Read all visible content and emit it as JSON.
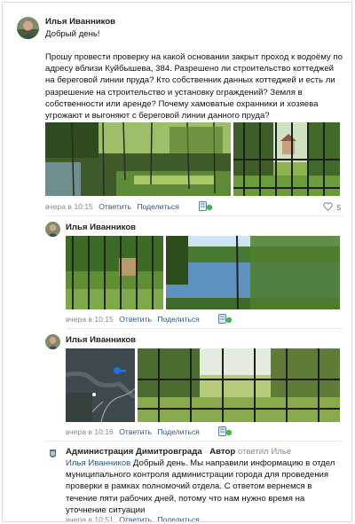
{
  "post": {
    "author": "Илья Иванников",
    "greeting": "Добрый день!",
    "body": "Прошу провести проверку на какой основании закрыт проход к водоёму по адресу вблизи Куйбышева, 384. Разрешено ли строительство коттеджей на береговой линии пруда? Кто собственник данных коттеджей и есть ли разрешение на строительство и установку ограждений? Земля в собственности или аренде? Почему хамоватые охранники и хозяева угрожают и выгоняют с береговой линии данного пруда?",
    "time": "вчера в 10:15",
    "reply": "Ответить",
    "share": "Поделиться",
    "likes": "5",
    "icon_doc": "document-badge-icon",
    "icon_heart": "heart-icon"
  },
  "comment1": {
    "author": "Илья Иванников",
    "time": "вчера в 10:15",
    "reply": "Ответить",
    "share": "Поделиться"
  },
  "comment2": {
    "author": "Илья Иванников",
    "time": "вчера в 10:16",
    "reply": "Ответить",
    "share": "Поделиться"
  },
  "admin": {
    "author": "Администрация Димитровграда",
    "dot": "·",
    "role": "Автор",
    "replied": "ответил Илье",
    "mention": "Илья Иванников",
    "body": " Добрый день. Мы направили информацию в отдел муниципального контроля администрации города для проведения проверки в рамках полномочий отдела. С ответом вернемся в течение пяти рабочих дней, потому что нам нужно время на уточнение ситуации",
    "time": "вчера в 10:51",
    "reply": "Ответить",
    "share": "Поделиться"
  },
  "colors": {
    "link": "#2a5885",
    "meta": "#818c99"
  }
}
